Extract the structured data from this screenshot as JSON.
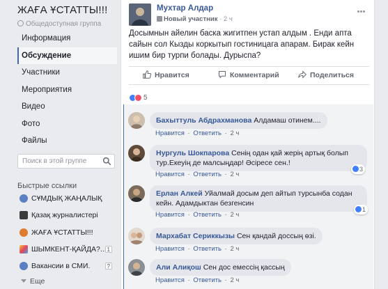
{
  "sidebar": {
    "group_name": "ЖАҒА ҰСТАТТЫ!!!",
    "group_privacy": "Общедоступная группа",
    "nav": [
      {
        "label": "Информация",
        "active": false
      },
      {
        "label": "Обсуждение",
        "active": true
      },
      {
        "label": "Участники",
        "active": false
      },
      {
        "label": "Мероприятия",
        "active": false
      },
      {
        "label": "Видео",
        "active": false
      },
      {
        "label": "Фото",
        "active": false
      },
      {
        "label": "Файлы",
        "active": false
      }
    ],
    "search_placeholder": "Поиск в этой группе",
    "quick_links_header": "Быстрые ссылки",
    "quick_links": [
      {
        "label": "СҰМДЫҚ ЖАҢАЛЫҚ",
        "icon": "group-icon",
        "badge": ""
      },
      {
        "label": "Қазақ журналистері",
        "icon": "group-icon",
        "badge": ""
      },
      {
        "label": "ЖАҒА ҰСТАТТЫ!!!",
        "icon": "group-icon",
        "badge": ""
      },
      {
        "label": "ШЫМКЕНТ-ҚАЙДА?...",
        "icon": "group-icon",
        "badge": "1"
      },
      {
        "label": "Вакансии в СМИ.",
        "icon": "group-icon",
        "badge": "?"
      }
    ],
    "more_label": "Еще"
  },
  "post": {
    "author": "Мухтар Алдар",
    "author_badge": "Новый участник",
    "time": "2 ч",
    "text": "Досымнын айелин баска жигитпен устап алдым . Енди апта сайын сол Кызды коркытып гостиницага апарам. Бирак кейн ишим бир турпи болады. Дурыспа?",
    "actions": {
      "like": "Нравится",
      "comment": "Комментарий",
      "share": "Поделиться"
    },
    "reaction_count": "5"
  },
  "comments": [
    {
      "author": "Бахыттуль Абдрахманова",
      "text": "Алдамаш отинем....",
      "like": "Нравится",
      "reply": "Ответить",
      "time": "2 ч",
      "reactions": ""
    },
    {
      "author": "Нургуль Шокпарова",
      "text": "Сенің одан қай жерің артық болып тур.Екеуің де малсыңдар! Әсіресе сен.!",
      "like": "Нравится",
      "reply": "Ответить",
      "time": "2 ч",
      "reactions": "3"
    },
    {
      "author": "Ерлан Алкей",
      "text": "Уйалмай досым деп айтып турсынба содан кейн. Адамдыктан безгенсин",
      "like": "Нравится",
      "reply": "Ответить",
      "time": "2 ч",
      "reactions": "1"
    },
    {
      "author": "Мархабат Сериккызы",
      "text": "Сен қандай доссың өзі.",
      "like": "Нравится",
      "reply": "Ответить",
      "time": "2 ч",
      "reactions": ""
    },
    {
      "author": "Али Алиқош",
      "text": "Сен дос емессің қассың",
      "like": "Нравится",
      "reply": "Ответить",
      "time": "2 ч",
      "reactions": ""
    }
  ],
  "colors": {
    "link": "#385898",
    "accent": "#4267b2",
    "background": "#e9ebee"
  }
}
